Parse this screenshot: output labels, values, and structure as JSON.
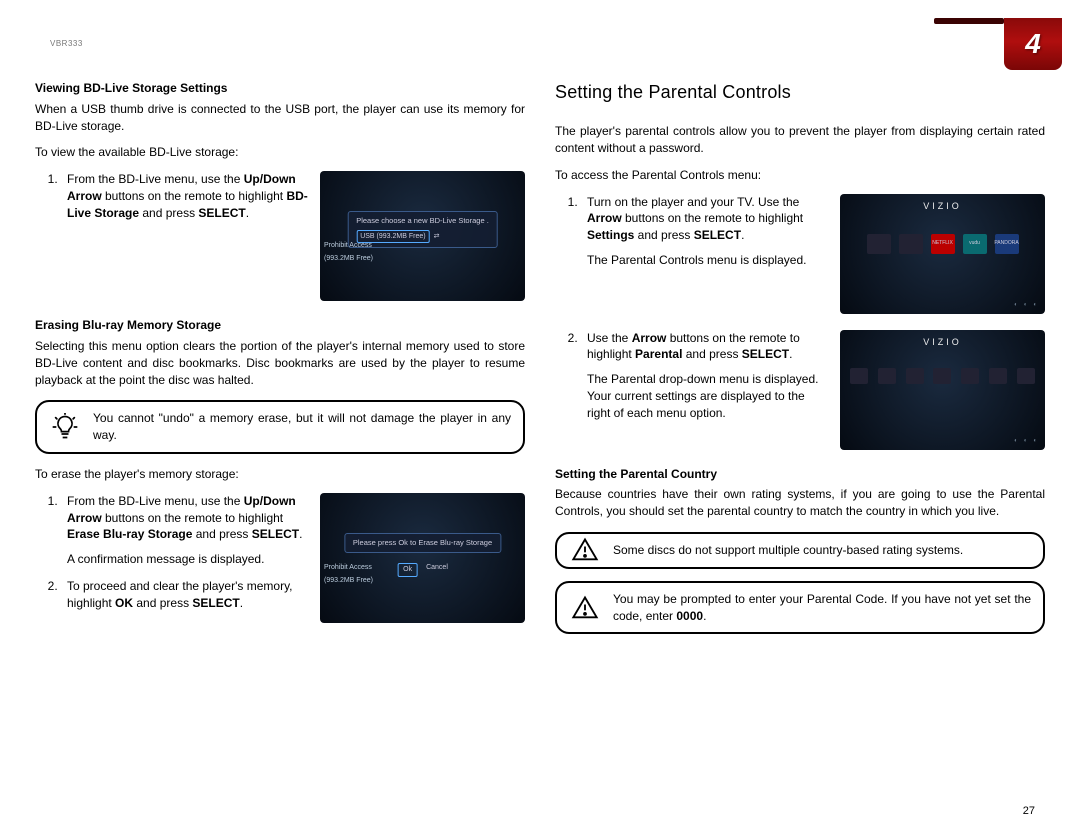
{
  "model": "VBR333",
  "chapter": "4",
  "page_number": "27",
  "left": {
    "sec1_title": "Viewing BD-Live Storage Settings",
    "sec1_p1": "When a USB thumb drive is connected to the USB port, the player can use its memory for BD-Live storage.",
    "sec1_p2": "To view the available BD-Live storage:",
    "sec1_step1_a": "From the BD-Live menu, use the ",
    "sec1_step1_b": "Up/Down Arrow",
    "sec1_step1_c": " buttons on the remote to highlight ",
    "sec1_step1_d": "BD-Live Storage",
    "sec1_step1_e": " and press ",
    "sec1_step1_f": "SELECT",
    "sec1_step1_g": ".",
    "ss1_line1": "Please choose a new BD-Live Storage .",
    "ss1_line2": "USB (993.2MB Free)",
    "ss1_side1": "Prohibit Access",
    "ss1_side2": "(993.2MB Free)",
    "sec2_title": "Erasing Blu-ray Memory Storage",
    "sec2_p1": "Selecting this menu option clears the portion of the player's internal memory used to store BD-Live content and disc bookmarks. Disc bookmarks are used by the player to resume playback at the point the disc was halted.",
    "note1": "You cannot \"undo\" a memory erase, but it will not damage the player in any way.",
    "sec2_p2": "To erase the player's memory storage:",
    "sec2_step1_a": "From the BD-Live menu, use the ",
    "sec2_step1_b": "Up/Down Arrow",
    "sec2_step1_c": " buttons on the remote to highlight ",
    "sec2_step1_d": "Erase Blu-ray Storage",
    "sec2_step1_e": " and press ",
    "sec2_step1_f": "SELECT",
    "sec2_step1_g": ".",
    "sec2_step1_extra": "A confirmation message is displayed.",
    "ss2_line1": "Please press Ok to Erase Blu-ray Storage",
    "ss2_ok": "Ok",
    "ss2_cancel": "Cancel",
    "sec2_step2_a": "To proceed and clear the player's memory, highlight ",
    "sec2_step2_b": "OK",
    "sec2_step2_c": " and press ",
    "sec2_step2_d": "SELECT",
    "sec2_step2_e": "."
  },
  "right": {
    "title": "Setting the Parental Controls",
    "p1": "The player's parental controls allow you to prevent the player from displaying certain rated content without a password.",
    "p2": "To access the Parental Controls menu:",
    "step1_a": "Turn on the player and your TV. Use the ",
    "step1_b": "Arrow",
    "step1_c": " buttons on the remote to highlight ",
    "step1_d": "Settings",
    "step1_e": " and press ",
    "step1_f": "SELECT",
    "step1_g": ".",
    "step1_extra": "The Parental Controls menu is displayed.",
    "ss3_brand": "VIZIO",
    "step2_a": "Use the ",
    "step2_b": "Arrow",
    "step2_c": " buttons on the remote to highlight ",
    "step2_d": "Parental",
    "step2_e": " and press ",
    "step2_f": "SELECT",
    "step2_g": ".",
    "step2_extra": "The Parental drop-down menu is displayed. Your current settings are displayed to the right of each menu option.",
    "sec2_title": "Setting the Parental Country",
    "sec2_p1": "Because countries have their own rating systems, if you are going to use the Parental Controls, you should set the parental country to match the country in which you live.",
    "note2": "Some discs do not support multiple country-based rating systems.",
    "note3_a": "You may be prompted to enter your Parental Code. If you have not yet set the code, enter ",
    "note3_b": "0000",
    "note3_c": "."
  }
}
